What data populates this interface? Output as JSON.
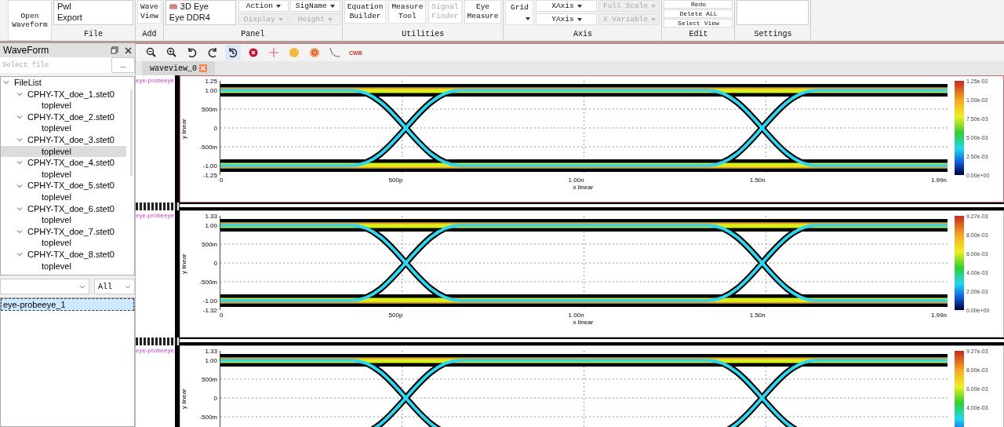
{
  "ribbon": {
    "open_button": "Open\nWaveform",
    "groups": [
      {
        "label": "File",
        "kind": "list",
        "items": [
          "Pwl",
          "Export"
        ]
      },
      {
        "label": "Add",
        "kind": "buttons",
        "buttons": [
          {
            "label": "Wave\nView",
            "disabled": false
          }
        ]
      },
      {
        "label": "Panel",
        "kind": "panel",
        "items": [
          "3D Eye",
          "Eye DDR4"
        ],
        "dropdowns": [
          {
            "label": "Action",
            "disabled": false
          },
          {
            "label": "SigName",
            "disabled": false
          },
          {
            "label": "Display",
            "disabled": true
          },
          {
            "label": "Height",
            "disabled": true
          }
        ]
      },
      {
        "label": "Utilities",
        "kind": "buttons",
        "buttons": [
          {
            "label": "Equation\nBuilder",
            "disabled": false
          },
          {
            "label": "Measure\nTool",
            "disabled": false
          },
          {
            "label": "Signal\nFinder",
            "disabled": true
          },
          {
            "label": "Eye\nMeasure",
            "disabled": false
          }
        ]
      },
      {
        "label": "Axis",
        "kind": "axis",
        "grid": "Grid",
        "dropdowns": [
          {
            "label": "XAxis",
            "disabled": false
          },
          {
            "label": "Full Scale",
            "disabled": true
          },
          {
            "label": "YAxis",
            "disabled": false
          },
          {
            "label": "X Variable",
            "disabled": true
          }
        ]
      },
      {
        "label": "Edit",
        "kind": "edit",
        "buttons": [
          "Redo",
          "Delete ALL",
          "Select View"
        ]
      },
      {
        "label": "Settings",
        "kind": "list"
      }
    ]
  },
  "sidebar": {
    "title": "WaveForm",
    "file_field": {
      "placeholder": "Select file"
    },
    "browse_button": "...",
    "tree": [
      {
        "label": "FileList",
        "expanded": true,
        "children": [
          {
            "label": "CPHY-TX_doe_1.stet0",
            "expanded": true,
            "children": [
              {
                "label": "toplevel",
                "selected": false
              }
            ]
          },
          {
            "label": "CPHY-TX_doe_2.stet0",
            "expanded": true,
            "children": [
              {
                "label": "toplevel",
                "selected": false
              }
            ]
          },
          {
            "label": "CPHY-TX_doe_3.stet0",
            "expanded": true,
            "children": [
              {
                "label": "toplevel",
                "selected": true
              }
            ]
          },
          {
            "label": "CPHY-TX_doe_4.stet0",
            "expanded": true,
            "children": [
              {
                "label": "toplevel",
                "selected": false
              }
            ]
          },
          {
            "label": "CPHY-TX_doe_5.stet0",
            "expanded": true,
            "children": [
              {
                "label": "toplevel",
                "selected": false
              }
            ]
          },
          {
            "label": "CPHY-TX_doe_6.stet0",
            "expanded": true,
            "children": [
              {
                "label": "toplevel",
                "selected": false
              }
            ]
          },
          {
            "label": "CPHY-TX_doe_7.stet0",
            "expanded": true,
            "children": [
              {
                "label": "toplevel",
                "selected": false
              }
            ]
          },
          {
            "label": "CPHY-TX_doe_8.stet0",
            "expanded": true,
            "children": [
              {
                "label": "toplevel",
                "selected": false
              }
            ]
          }
        ]
      }
    ],
    "filter": {
      "value": "All"
    },
    "signals": [
      {
        "label": "eye-probeeye_1",
        "selected": true
      }
    ]
  },
  "toolbar": [
    {
      "kind": "zoom-out",
      "selected": false
    },
    {
      "kind": "zoom-in",
      "selected": false
    },
    {
      "kind": "undo",
      "selected": false
    },
    {
      "kind": "redo",
      "selected": false
    },
    {
      "kind": "reset",
      "selected": true
    },
    {
      "kind": "stop",
      "selected": false
    },
    {
      "kind": "cross",
      "selected": false
    },
    {
      "kind": "dot-yellow",
      "selected": false
    },
    {
      "kind": "dot-orange",
      "selected": false
    },
    {
      "kind": "curve",
      "selected": false
    },
    {
      "kind": "text",
      "label": "CWB",
      "selected": false
    }
  ],
  "tabs": [
    {
      "label": "waveview_0",
      "selected": true
    }
  ],
  "plots": [
    {
      "signal": "eye-probeeye",
      "selected": true,
      "yticks": [
        "1.25",
        "1.00",
        "500m",
        "0",
        "-500m",
        "-1.00",
        "-1.25"
      ],
      "xticks": [
        "0",
        "500p",
        "1.00n",
        "1.50n",
        "1.99n"
      ],
      "xlabel": "x linear",
      "ylabel": "y linear",
      "colorbar": [
        "1.25e-02",
        "1.00e-02",
        "7.50e-03",
        "5.00e-03",
        "2.50e-03",
        "0.00e+00"
      ]
    },
    {
      "signal": "eye-probeeye",
      "selected": false,
      "yticks": [
        "1.33",
        "1.00",
        "500m",
        "0",
        "-500m",
        "-1.00",
        "-1.32"
      ],
      "xticks": [
        "0",
        "500p",
        "1.00n",
        "1.50n",
        "1.99n"
      ],
      "xlabel": "x linear",
      "ylabel": "y linear",
      "colorbar": [
        "9.27e-03",
        "8.00e-03",
        "6.00e-03",
        "4.00e-03",
        "2.00e-03",
        "0.00e+00"
      ]
    },
    {
      "signal": "eye-probeeye",
      "selected": false,
      "yticks": [
        "1.33",
        "1.00",
        "500m",
        "0",
        "-500m"
      ],
      "ylabel": "y linear",
      "colorbar": [
        "9.27e-03",
        "8.00e-03",
        "6.00e-03",
        "4.00e-03"
      ]
    }
  ]
}
